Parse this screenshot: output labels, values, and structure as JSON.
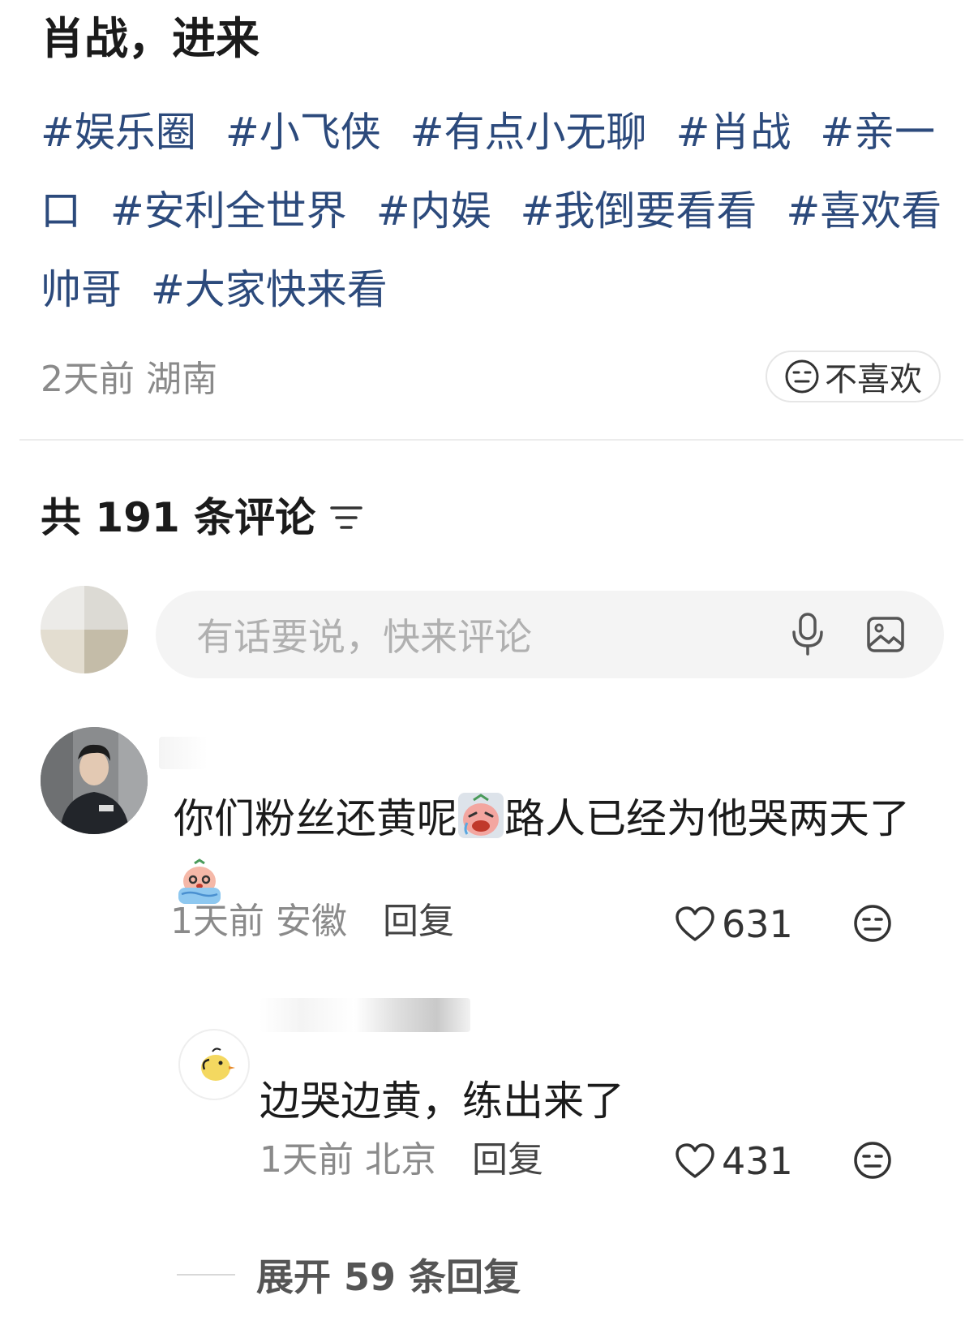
{
  "post": {
    "title": "肖战，进来",
    "tags": [
      "#娱乐圈",
      "#小飞侠",
      "#有点小无聊",
      "#肖战",
      "#亲一口",
      "#安利全世界",
      "#内娱",
      "#我倒要看看",
      "#喜欢看帅哥",
      "#大家快来看"
    ],
    "time": "2天前",
    "location": "湖南",
    "dislike_label": "不喜欢"
  },
  "comments_header": {
    "label": "共 191 条评论"
  },
  "comment_input": {
    "placeholder": "有话要说，快来评论"
  },
  "comments": [
    {
      "text_part1": "你们粉丝还黄呢",
      "emoji1": "crying-face-emoji",
      "text_part2": "路人已经为他哭两天了",
      "emoji2": "sobbing-tears-emoji",
      "time": "1天前",
      "location": "安徽",
      "reply_label": "回复",
      "likes": "631",
      "reply": {
        "text": "边哭边黄，练出来了",
        "time": "1天前",
        "location": "北京",
        "reply_label": "回复",
        "likes": "431"
      },
      "expand_label": "展开 59 条回复"
    }
  ],
  "colors": {
    "tag": "#2c4a7c",
    "meta": "#8a8a8a",
    "input_bg": "#f4f4f4"
  }
}
